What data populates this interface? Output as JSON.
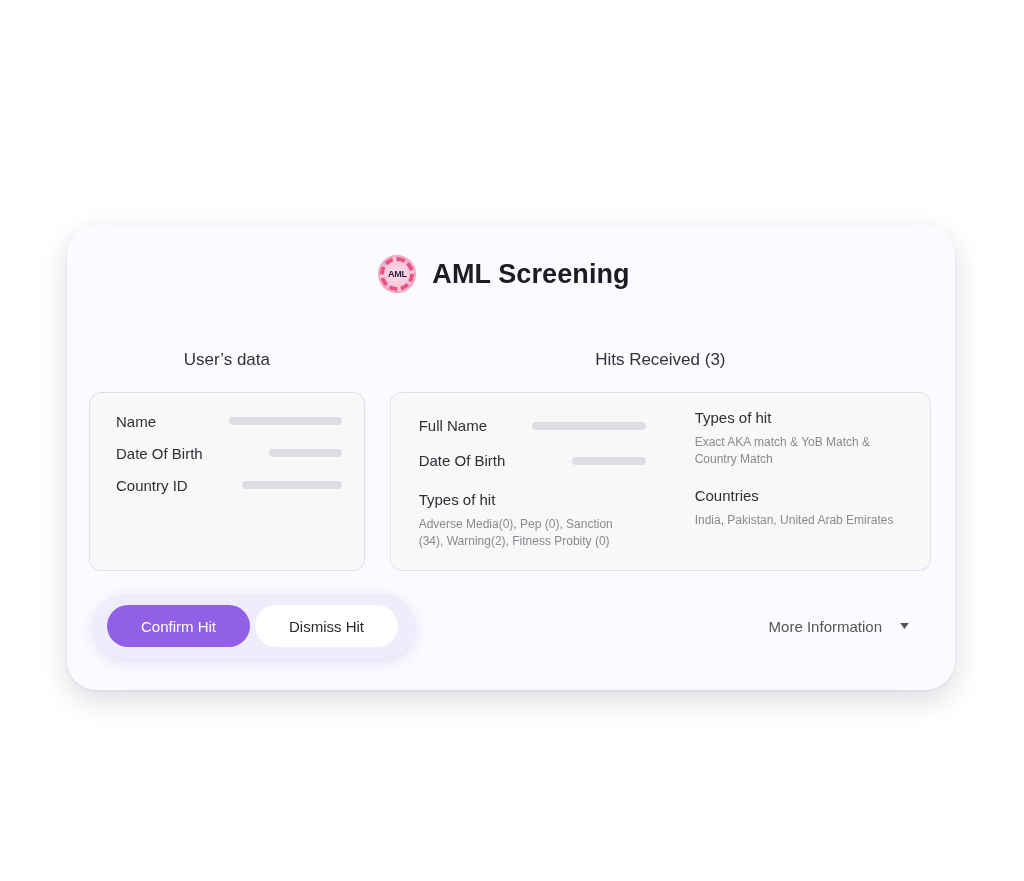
{
  "card": {
    "logo": "AML",
    "title": "AML Screening"
  },
  "user_data": {
    "heading": "User’s data",
    "fields": [
      {
        "label": "Name"
      },
      {
        "label": "Date Of Birth"
      },
      {
        "label": "Country ID"
      }
    ]
  },
  "hits": {
    "heading": "Hits Received (3)",
    "columns": [
      {
        "fields": [
          {
            "label": "Full Name"
          },
          {
            "label": "Date Of Birth"
          }
        ],
        "sections": [
          {
            "label": "Types of hit",
            "text": "Adverse Media(0), Pep (0), Sanction (34), Warning(2), Fitness Probity (0)"
          }
        ]
      },
      {
        "sections": [
          {
            "label": "Types of hit",
            "text": "Exact AKA match & YoB Match & Country Match"
          },
          {
            "label": "Countries",
            "text": "India, Pakistan, United Arab Emirates"
          }
        ]
      }
    ]
  },
  "actions": {
    "buttons": [
      {
        "label": "Confirm Hit",
        "selected": true
      },
      {
        "label": "Dismiss Hit",
        "selected": false
      }
    ],
    "more": {
      "label": "More Information"
    }
  }
}
